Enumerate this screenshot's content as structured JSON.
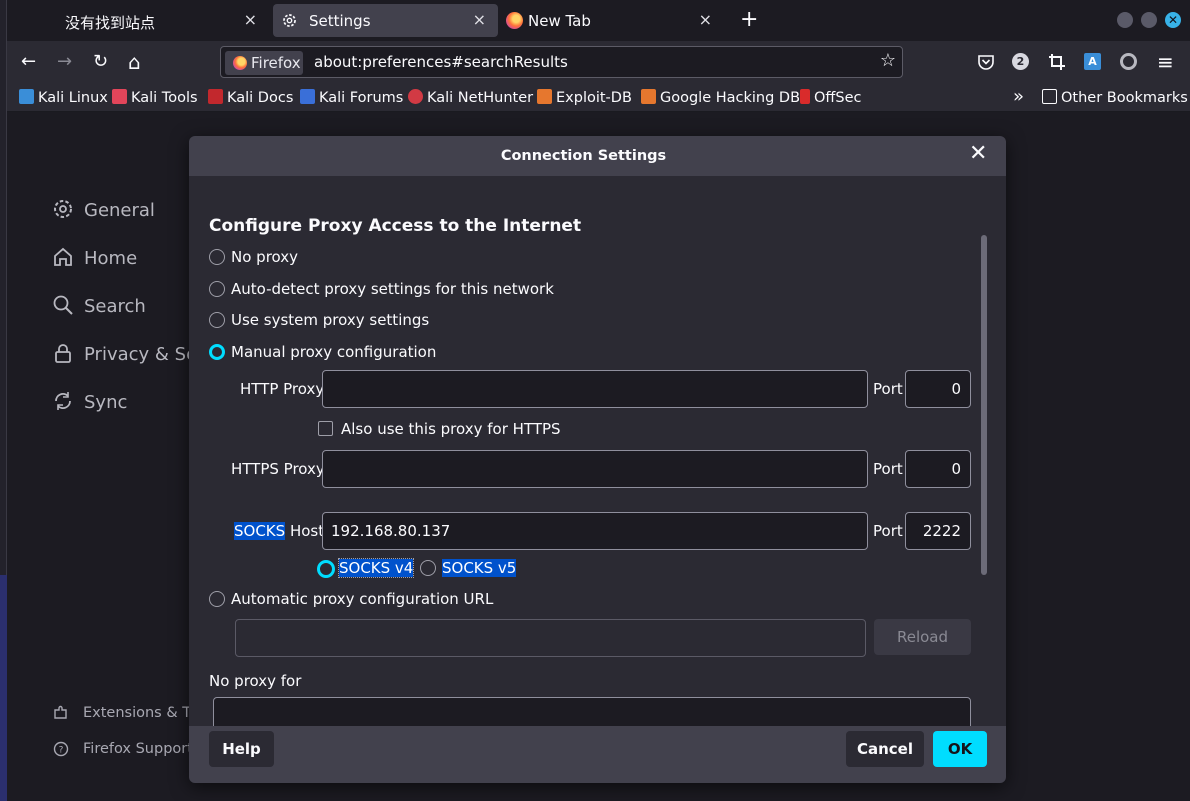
{
  "tabs": [
    {
      "title": "没有找到站点",
      "close": "×"
    },
    {
      "title": "Settings",
      "close": "×"
    },
    {
      "title": "New Tab",
      "close": "×"
    }
  ],
  "newtab": "+",
  "window_close": "✕",
  "nav": {
    "back": "←",
    "forward": "→",
    "reload": "↻",
    "home": "⌂"
  },
  "urlbar": {
    "identity": "Firefox",
    "url": "about:preferences#searchResults",
    "star": "☆"
  },
  "toolbar": {
    "downloads_badge": "2",
    "menu": "≡"
  },
  "bookmarks": [
    {
      "label": "Kali Linux",
      "color": "#3a8ed8"
    },
    {
      "label": "Kali Tools",
      "color": "#e2455a"
    },
    {
      "label": "Kali Docs",
      "color": "#c2282d"
    },
    {
      "label": "Kali Forums",
      "color": "#3a6fd8"
    },
    {
      "label": "Kali NetHunter",
      "color": "#d23a44"
    },
    {
      "label": "Exploit-DB",
      "color": "#e6772e"
    },
    {
      "label": "Google Hacking DB",
      "color": "#e6772e"
    },
    {
      "label": "OffSec",
      "color": "#d92b2b"
    }
  ],
  "bookmarks_overflow": "»",
  "other_bookmarks": "Other Bookmarks",
  "sidebar": {
    "items": [
      {
        "label": "General"
      },
      {
        "label": "Home"
      },
      {
        "label": "Search"
      },
      {
        "label": "Privacy & Secu"
      },
      {
        "label": "Sync"
      }
    ],
    "footer": [
      {
        "label": "Extensions & The"
      },
      {
        "label": "Firefox Support"
      }
    ]
  },
  "dialog": {
    "title": "Connection Settings",
    "close": "✕",
    "heading": "Configure Proxy Access to the Internet",
    "options": {
      "no_proxy": "No proxy",
      "auto_detect": "Auto-detect proxy settings for this network",
      "system": "Use system proxy settings",
      "manual": "Manual proxy configuration",
      "auto_url": "Automatic proxy configuration URL"
    },
    "selected_option": "manual",
    "http_proxy": {
      "label": "HTTP Proxy",
      "value": "",
      "port_label": "Port",
      "port": "0"
    },
    "also_https": "Also use this proxy for HTTPS",
    "https_proxy": {
      "label": "HTTPS Proxy",
      "value": "",
      "port_label": "Port",
      "port": "0"
    },
    "socks": {
      "label_hl": "SOCKS",
      "label_rest": " Host",
      "value": "192.168.80.137",
      "port_label": "Port",
      "port": "2222"
    },
    "socks_v4": "SOCKS v4",
    "socks_v5": "SOCKS v5",
    "socks_selected": "v4",
    "auto_url_value": "",
    "reload": "Reload",
    "no_proxy_for": "No proxy for",
    "no_proxy_value": "",
    "help": "Help",
    "cancel": "Cancel",
    "ok": "OK"
  },
  "colors": {
    "accent": "#00ddff",
    "highlight": "#0052cc",
    "dialog_bg": "#42414d"
  }
}
